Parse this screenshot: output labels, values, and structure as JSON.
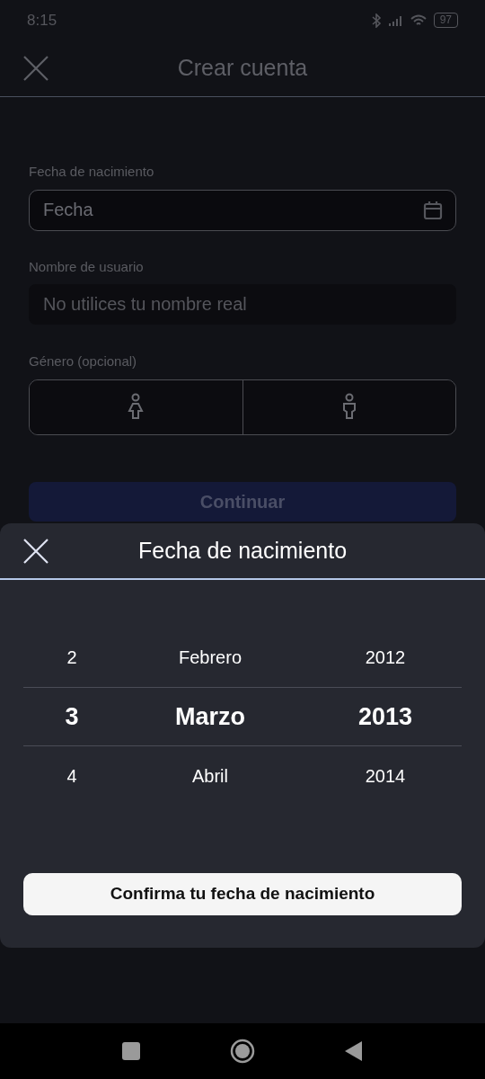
{
  "status_bar": {
    "time": "8:15",
    "battery": "97"
  },
  "header": {
    "title": "Crear cuenta"
  },
  "form": {
    "birthdate": {
      "label": "Fecha de nacimiento",
      "placeholder": "Fecha"
    },
    "username": {
      "label": "Nombre de usuario",
      "placeholder": "No utilices tu nombre real"
    },
    "gender": {
      "label": "Género (opcional)",
      "options": [
        {
          "kind": "female",
          "selected": false
        },
        {
          "kind": "male",
          "selected": false
        }
      ]
    },
    "continue_button": {
      "label": "Continuar",
      "disabled": true
    }
  },
  "sheet": {
    "title": "Fecha de nacimiento",
    "picker_rows": [
      {
        "day": "2",
        "month": "Febrero",
        "year": "2012",
        "selected": false
      },
      {
        "day": "3",
        "month": "Marzo",
        "year": "2013",
        "selected": true
      },
      {
        "day": "4",
        "month": "Abril",
        "year": "2014",
        "selected": false
      }
    ],
    "confirm_button": "Confirma tu fecha de nacimiento"
  }
}
